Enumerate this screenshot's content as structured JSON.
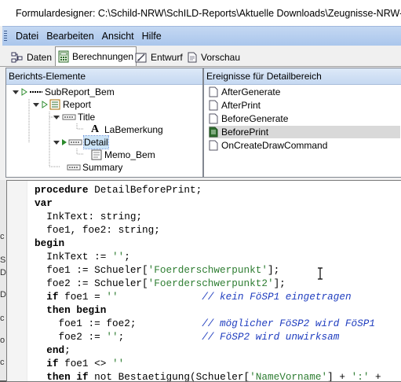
{
  "window": {
    "title": "Formulardesigner: C:\\Schild-NRW\\SchILD-Reports\\Aktuelle Downloads\\Zeugnisse-NRW-A"
  },
  "menu": [
    "Datei",
    "Bearbeiten",
    "Ansicht",
    "Hilfe"
  ],
  "tabs": [
    {
      "label": "Daten",
      "icon": "data-icon"
    },
    {
      "label": "Berechnungen",
      "icon": "calculator-icon",
      "active": true
    },
    {
      "label": "Entwurf",
      "icon": "design-icon"
    },
    {
      "label": "Vorschau",
      "icon": "preview-icon"
    }
  ],
  "elements_panel": {
    "header": "Berichts-Elemente",
    "tree": [
      {
        "label": "SubReport_Bem"
      },
      {
        "label": "Report"
      },
      {
        "label": "Title"
      },
      {
        "label": "LaBemerkung"
      },
      {
        "label": "Detail",
        "selected": true
      },
      {
        "label": "Memo_Bem"
      },
      {
        "label": "Summary"
      }
    ]
  },
  "events_panel": {
    "header": "Ereignisse für Detailbereich",
    "events": [
      {
        "label": "AfterGenerate"
      },
      {
        "label": "AfterPrint"
      },
      {
        "label": "BeforeGenerate"
      },
      {
        "label": "BeforePrint",
        "selected": true
      },
      {
        "label": "OnCreateDrawCommand"
      }
    ]
  },
  "code_lines": [
    "procedure DetailBeforePrint;",
    "var",
    "  InkText: string;",
    "  foe1, foe2: string;",
    "begin",
    "  InkText := '';",
    "  foe1 := Schueler['Foerderschwerpunkt'];",
    "  foe2 := Schueler['Foerderschwerpunkt2'];",
    "  if foe1 = ''              // kein FöSP1 eingetragen",
    "  then begin",
    "    foe1 := foe2;           // möglicher FöSP2 wird FöSP1",
    "    foe2 := '';             // FöSP2 wird unwirksam",
    "  end;",
    "  if foe1 <> ''",
    "  then if not Bestaetigung(Schueler['NameVorname'] + ':' +"
  ],
  "left_strip_glyphs": [
    "c",
    "S",
    "D",
    "D",
    "c",
    "o",
    "c"
  ]
}
